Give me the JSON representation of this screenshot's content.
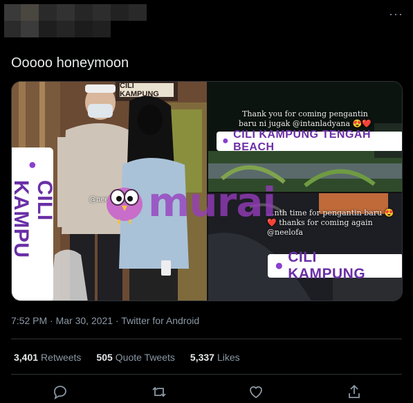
{
  "tweet": {
    "text": "Ooooo honeymoon",
    "more_icon": "···"
  },
  "media": {
    "left": {
      "sign_text": "CILI KAMPUNG",
      "sticker": "CILI KAMPU",
      "mention": "@neelofa"
    },
    "top_right": {
      "caption": "Thank you for coming pengantin baru ni jugak @intanladyana 😍❤️",
      "sticker": "CILI KAMPUNG TENGAH BEACH"
    },
    "bottom_right": {
      "caption": "...nth time for pengantin baru 😍❤️ thanks for coming again @neelofa",
      "sticker": "CILI KAMPUNG"
    },
    "watermark": "murai"
  },
  "meta": {
    "time": "7:52 PM",
    "date": "Mar 30, 2021",
    "source": "Twitter for Android",
    "separator": "·"
  },
  "stats": {
    "retweets_count": "3,401",
    "retweets_label": "Retweets",
    "quotes_count": "505",
    "quotes_label": "Quote Tweets",
    "likes_count": "5,337",
    "likes_label": "Likes"
  },
  "colors": {
    "background": "#000000",
    "text": "#e7e9ea",
    "secondary": "#8b98a5",
    "divider": "#2f3336",
    "sticker_purple": "#6a2fa6"
  }
}
